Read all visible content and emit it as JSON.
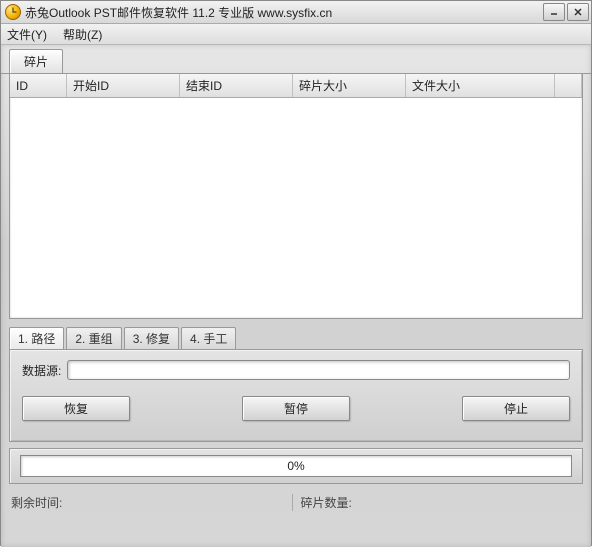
{
  "titlebar": {
    "title": "赤兔Outlook PST邮件恢复软件 11.2 专业版 www.sysfix.cn"
  },
  "menu": {
    "file": "文件(Y)",
    "help": "帮助(Z)"
  },
  "upper_tab": {
    "fragments": "碎片"
  },
  "table": {
    "columns": {
      "id": "ID",
      "start_id": "开始ID",
      "end_id": "结束ID",
      "frag_size": "碎片大小",
      "file_size": "文件大小"
    },
    "rows": []
  },
  "lower_tabs": {
    "t1": "1. 路径",
    "t2": "2. 重组",
    "t3": "3. 修复",
    "t4": "4. 手工"
  },
  "panel": {
    "source_label": "数据源:",
    "source_value": "",
    "btn_recover": "恢复",
    "btn_pause": "暂停",
    "btn_stop": "停止"
  },
  "progress": {
    "text": "0%"
  },
  "status": {
    "remaining_label": "剩余时间:",
    "remaining_value": "",
    "frag_count_label": "碎片数量:",
    "frag_count_value": ""
  }
}
